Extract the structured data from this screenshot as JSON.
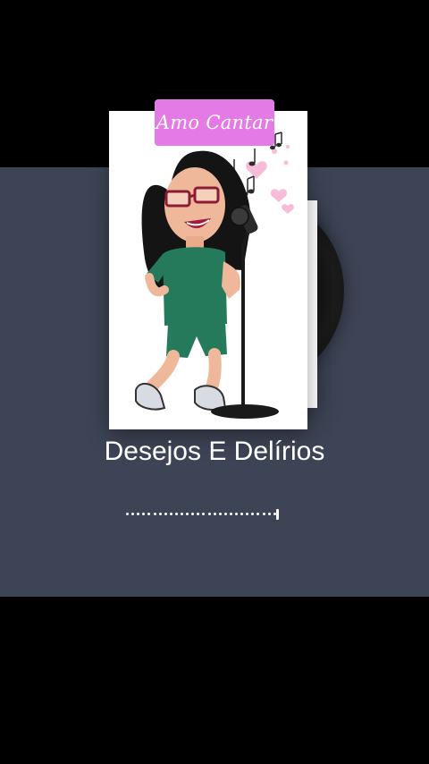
{
  "player": {
    "cover_badge": "Amo Cantar",
    "song_title": "Desejos E Delírios",
    "progress_fraction": 0.94
  },
  "icons": {
    "music_notes": "music-notes-icon",
    "microphone": "microphone-icon"
  },
  "colors": {
    "panel_background": "#3d4455",
    "letterbox": "#000000",
    "badge_background": "#e37ae6",
    "title_text": "#ffffff"
  }
}
